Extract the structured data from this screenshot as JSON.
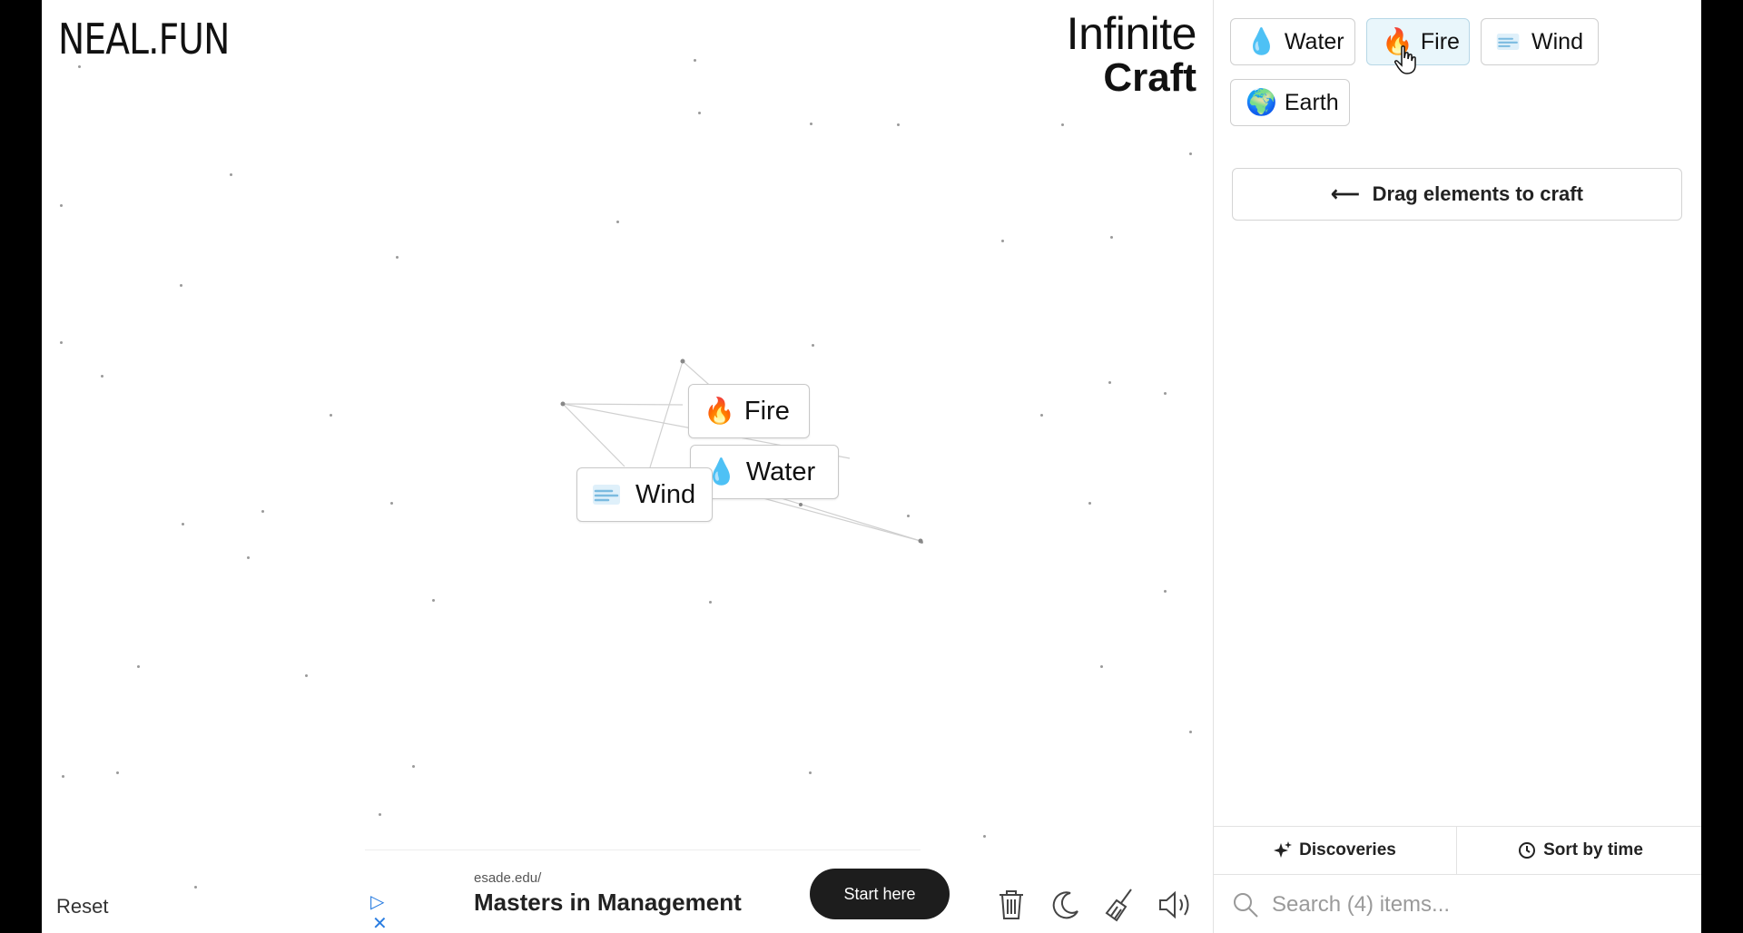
{
  "header": {
    "logo": "NEAL.FUN",
    "title_line1": "Infinite",
    "title_line2": "Craft"
  },
  "canvas": {
    "elements": [
      {
        "label": "Fire",
        "icon": "fire-icon"
      },
      {
        "label": "Water",
        "icon": "water-drop-icon"
      },
      {
        "label": "Wind",
        "icon": "wind-icon"
      }
    ]
  },
  "footer": {
    "reset_label": "Reset"
  },
  "ad": {
    "url": "esade.edu/",
    "headline": "Masters in Management",
    "cta": "Start here"
  },
  "toolbar": {
    "icons": [
      "trash-icon",
      "moon-icon",
      "broom-icon",
      "speaker-icon"
    ]
  },
  "sidebar": {
    "items": [
      {
        "label": "Water",
        "icon": "water-drop-icon"
      },
      {
        "label": "Fire",
        "icon": "fire-icon"
      },
      {
        "label": "Wind",
        "icon": "wind-icon"
      },
      {
        "label": "Earth",
        "icon": "earth-globe-icon"
      }
    ],
    "hint": "Drag elements to craft",
    "discoveries_label": "Discoveries",
    "sort_label": "Sort by time",
    "search_placeholder": "Search (4) items..."
  },
  "colors": {
    "accent_hover": "#e9f6fb",
    "ad_button": "#1d1d1d"
  }
}
